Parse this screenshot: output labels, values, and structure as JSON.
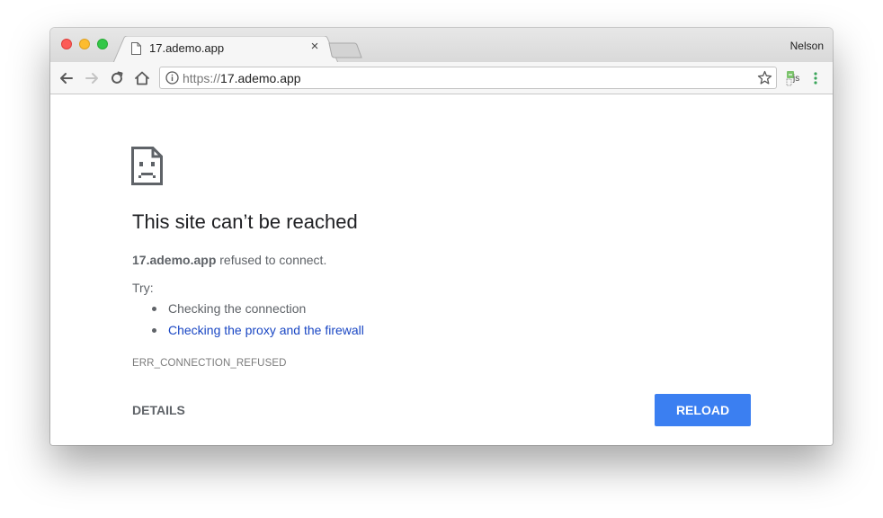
{
  "window": {
    "profile_name": "Nelson"
  },
  "tab": {
    "title": "17.ademo.app",
    "close_glyph": "×"
  },
  "toolbar": {
    "url_scheme": "https://",
    "url_host": "17.ademo.app",
    "extension_label": "js"
  },
  "error_page": {
    "headline": "This site can’t be reached",
    "host": "17.ademo.app",
    "summary_rest": " refused to connect.",
    "try_label": "Try:",
    "suggestions": [
      "Checking the connection",
      "Checking the proxy and the firewall"
    ],
    "error_code": "ERR_CONNECTION_REFUSED",
    "details_label": "DETAILS",
    "reload_label": "RELOAD"
  },
  "colors": {
    "reload_button": "#3b7ff1",
    "link": "#1a47c4",
    "close_light": "#fc5b57",
    "minimize_light": "#fdbc2f",
    "maximize_light": "#33c748"
  },
  "icons": {
    "tab": "page-icon",
    "back": "arrow-left-icon",
    "forward": "arrow-right-icon",
    "reload": "reload-icon",
    "home": "home-icon",
    "info": "info-icon",
    "bookmark": "star-icon",
    "extension": "extension-js-icon",
    "menu": "kebab-menu-icon",
    "error": "sad-page-icon"
  }
}
